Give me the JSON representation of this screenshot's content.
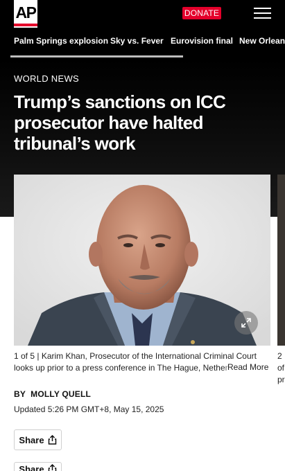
{
  "header": {
    "logo_text": "AP",
    "donate_label": "DONATE",
    "menu_icon": "hamburger-menu-icon"
  },
  "nav": {
    "items": [
      "Palm Springs explosion",
      "Sky vs. Fever",
      "Eurovision final",
      "New Orleans"
    ]
  },
  "article": {
    "section": "WORLD NEWS",
    "headline": "Trump’s sanctions on ICC prosecutor have halted tribunal’s work",
    "photo": {
      "counter": "1 of 5",
      "caption": "Karim Khan, Prosecutor of the International Criminal Court looks up prior to a press conference in The Hague, Nether",
      "read_more": "Read More",
      "next_caption_start": "2 of",
      "next_caption_line2": "pr"
    },
    "byline_prefix": "BY",
    "author": "MOLLY QUELL",
    "updated": "Updated 5:26 PM GMT+8, May 15, 2025",
    "share_label": "Share"
  },
  "colors": {
    "brand_red": "#e4002b",
    "header_bg": "#000000"
  }
}
